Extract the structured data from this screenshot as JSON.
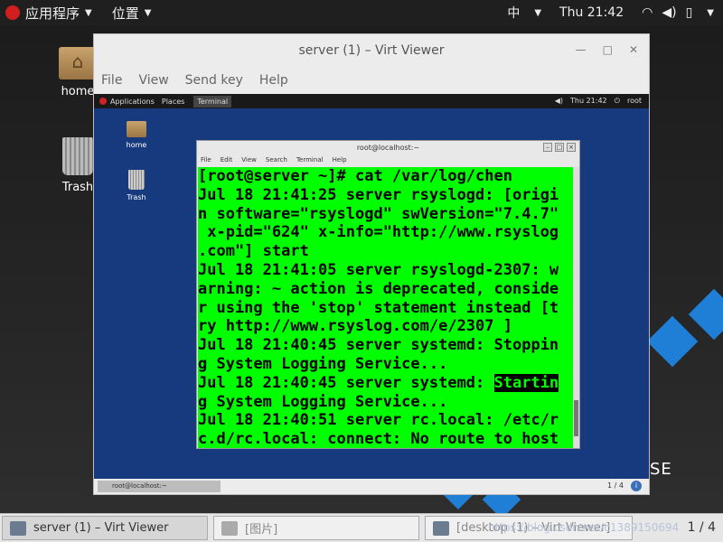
{
  "host_topbar": {
    "apps_label": "应用程序",
    "places_label": "位置",
    "input_method": "中",
    "clock": "Thu 21:42"
  },
  "host_desktop": {
    "icons": [
      {
        "label": "home"
      },
      {
        "label": "Trash"
      }
    ],
    "partial_text": "SE"
  },
  "viewer": {
    "title": "server (1) – Virt Viewer",
    "menu": [
      "File",
      "View",
      "Send key",
      "Help"
    ]
  },
  "guest_topbar": {
    "applications": "Applications",
    "places": "Places",
    "terminal": "Terminal",
    "clock": "Thu 21:42",
    "user": "root"
  },
  "guest_desktop": {
    "icons": [
      {
        "label": "home"
      },
      {
        "label": "Trash"
      }
    ]
  },
  "terminal": {
    "title": "root@localhost:~",
    "menu": [
      "File",
      "Edit",
      "View",
      "Search",
      "Terminal",
      "Help"
    ],
    "lines": [
      "[root@server ~]# cat /var/log/chen",
      "Jul 18 21:41:25 server rsyslogd: [origi",
      "n software=\"rsyslogd\" swVersion=\"7.4.7\"",
      " x-pid=\"624\" x-info=\"http://www.rsyslog",
      ".com\"] start",
      "Jul 18 21:41:05 server rsyslogd-2307: w",
      "arning: ~ action is deprecated, conside",
      "r using the 'stop' statement instead [t",
      "ry http://www.rsyslog.com/e/2307 ]",
      "Jul 18 21:40:45 server systemd: Stoppin",
      "g System Logging Service...",
      "Jul 18 21:40:45 server systemd: ",
      "g System Logging Service...",
      "Jul 18 21:40:51 server rc.local: /etc/r",
      "c.d/rc.local: connect: No route to host"
    ],
    "highlight_text": "Startin",
    "colors": {
      "background": "#00ff00",
      "foreground": "#000000"
    }
  },
  "guest_taskbar": {
    "item": "root@localhost:~",
    "pager": "1 / 4"
  },
  "host_taskbar": {
    "tasks": [
      "server (1) – Virt Viewer",
      "[图片]",
      "[desktop (1) – Virt Viewer]"
    ],
    "pager": "1 / 4",
    "watermark": "https://blog.csdn.net/c1389150694"
  }
}
